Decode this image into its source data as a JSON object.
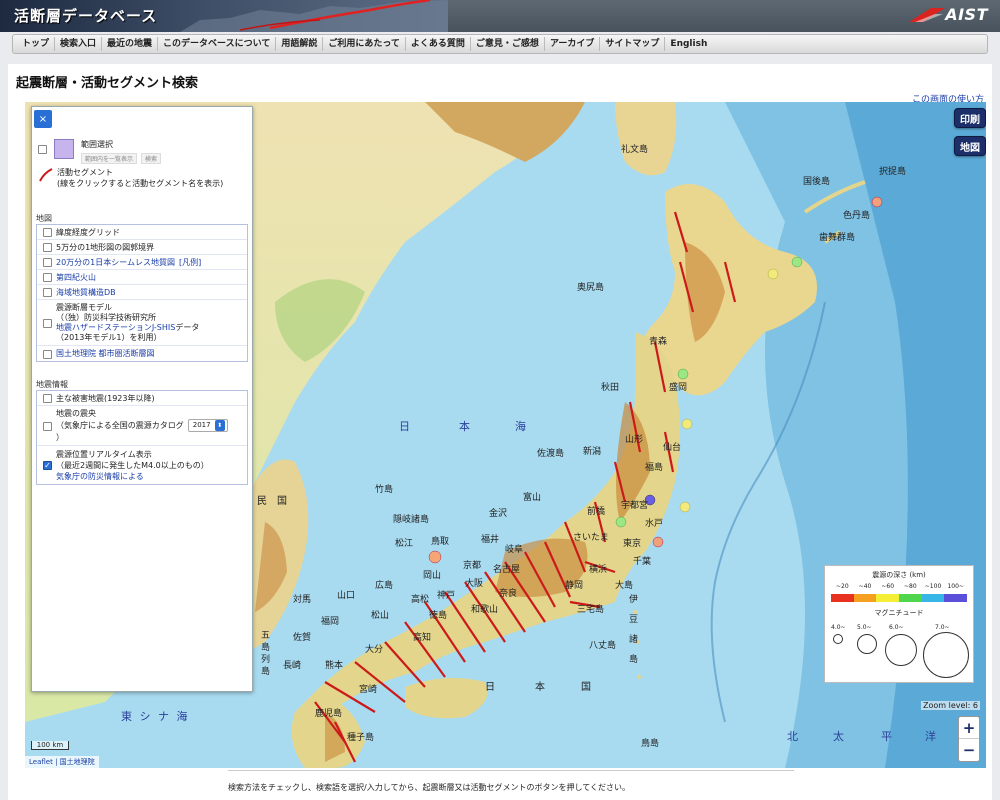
{
  "header": {
    "site_title": "活断層データベース",
    "logo_text": "AIST"
  },
  "nav": {
    "items": [
      {
        "label": "トップ"
      },
      {
        "label": "検索入口"
      },
      {
        "label": "最近の地震"
      },
      {
        "label": "このデータベースについて"
      },
      {
        "label": "用語解説"
      },
      {
        "label": "ご利用にあたって"
      },
      {
        "label": "よくある質問"
      },
      {
        "label": "ご意見・ご感想"
      },
      {
        "label": "アーカイブ"
      },
      {
        "label": "サイトマップ"
      },
      {
        "label": "English"
      }
    ]
  },
  "page": {
    "title": "起震断層・活動セグメント検索",
    "help_link": "この画面の使い方",
    "footer_instruction": "検索方法をチェックし、検索語を選択/入力してから、起震断層又は活動セグメントのボタンを押してください。"
  },
  "map_buttons": {
    "print": "印刷",
    "map": "地図"
  },
  "panel": {
    "close_icon": "×",
    "range_select": {
      "label": "範囲選択",
      "btn_a": "範囲内を一覧表示",
      "btn_b": "検索"
    },
    "segment": {
      "label": "活動セグメント",
      "desc": "(線をクリックすると活動セグメント名を表示)"
    },
    "map_section": {
      "title": "地図",
      "items": [
        {
          "label": "緯度経度グリッド",
          "link": false,
          "checked": false
        },
        {
          "label": "5万分の1地形図の図郭境界",
          "link": false,
          "checked": false
        },
        {
          "label": "20万分の1日本シームレス地質図",
          "link": true,
          "checked": false,
          "suffix": "[凡例]"
        },
        {
          "label": "第四紀火山",
          "link": true,
          "checked": false
        },
        {
          "label": "海域地質構造DB",
          "link": true,
          "checked": false
        }
      ],
      "hazard_model": {
        "line1": "震源断層モデル",
        "line2": "（（独）防災科学技術研究所",
        "line3": "地震ハザードステーションJ-SHIS",
        "line3b": "データ",
        "line4": "（2013年モデル1）を利用）"
      },
      "gsi": {
        "label": "国土地理院 都市圏活断層図"
      }
    },
    "quake_section": {
      "title": "地震情報",
      "major": {
        "label": "主な被害地震(1923年以降)",
        "checked": false
      },
      "epicenter": {
        "line1": "地震の震央",
        "line2": "（気象庁による全国の震源カタログ",
        "line3": "）",
        "year": "2017",
        "checked": false
      },
      "realtime": {
        "line1": "震源位置リアルタイム表示",
        "line2": "（最近2週間に発生したM4.0以上のもの）",
        "link": "気象庁の防災情報による",
        "checked": true
      }
    }
  },
  "legend": {
    "depth_title": "震源の深さ (km)",
    "depth_labels": [
      "~20",
      "~40",
      "~60",
      "~80",
      "~100",
      "100~"
    ],
    "depth_colors": [
      "#e8321f",
      "#f5a01f",
      "#f4ee35",
      "#4fd64d",
      "#39b6e8",
      "#5a4fd8"
    ],
    "magnitude_title": "マグニチュード",
    "magnitude_labels": [
      "4.0~",
      "5.0~",
      "6.0~",
      "7.0~"
    ]
  },
  "map": {
    "zoom_level": "Zoom level: 6",
    "zoom_in": "+",
    "zoom_out": "−",
    "scale": "100 km",
    "attribution_a": "Leaflet",
    "attribution_b": "国土地理院",
    "labels": {
      "sea_japan_a": "日",
      "sea_japan_b": "本",
      "sea_japan_c": "海",
      "east_china_sea": "東 シ ナ 海",
      "pacific_a": "北",
      "pacific_b": "太",
      "pacific_c": "平",
      "pacific_d": "洋",
      "japan_a": "日",
      "japan_b": "本",
      "japan_c": "国",
      "korea_a": "民",
      "korea_b": "国",
      "rebun": "礼文島",
      "kunashiri": "国後島",
      "etorofu": "択捉島",
      "shikotan": "色丹島",
      "habomai": "歯舞群島",
      "okushiri": "奥尻島",
      "aomori": "青森",
      "akita": "秋田",
      "morioka": "盛岡",
      "yamagata": "山形",
      "sendai": "仙台",
      "fukushima": "福島",
      "niigata": "新潟",
      "sado": "佐渡島",
      "toyama": "富山",
      "kanazawa": "金沢",
      "fukui": "福井",
      "maebashi": "前橋",
      "utsunomiya": "宇都宮",
      "mito": "水戸",
      "saitama": "さいたま",
      "tokyo": "東京",
      "chiba": "千葉",
      "yokohama": "横浜",
      "shizuoka": "静岡",
      "nagoya": "名古屋",
      "gifu": "岐阜",
      "kyoto": "京都",
      "osaka": "大阪",
      "kobe": "神戸",
      "wakayama": "和歌山",
      "nara": "奈良",
      "tottori": "鳥取",
      "matsue": "松江",
      "okayama": "岡山",
      "hiroshima": "広島",
      "yamaguchi": "山口",
      "takamatsu": "高松",
      "tokushima": "徳島",
      "kochi": "高知",
      "matsuyama": "松山",
      "fukuoka": "福岡",
      "saga": "佐賀",
      "nagasaki": "長崎",
      "kumamoto": "熊本",
      "oita": "大分",
      "miyazaki": "宮崎",
      "kagoshima": "鹿児島",
      "takeshima": "竹島",
      "oki": "隠岐諸島",
      "tsushima": "対馬",
      "oshima": "大島",
      "miyake": "三宅島",
      "hachijo": "八丈島",
      "tanegashima": "種子島",
      "kuchinoshima": "鳥島",
      "izu1": "伊",
      "izu2": "豆",
      "izu3": "諸",
      "izu4": "島",
      "goto1": "五",
      "goto2": "島",
      "goto3": "列",
      "goto4": "島"
    }
  }
}
